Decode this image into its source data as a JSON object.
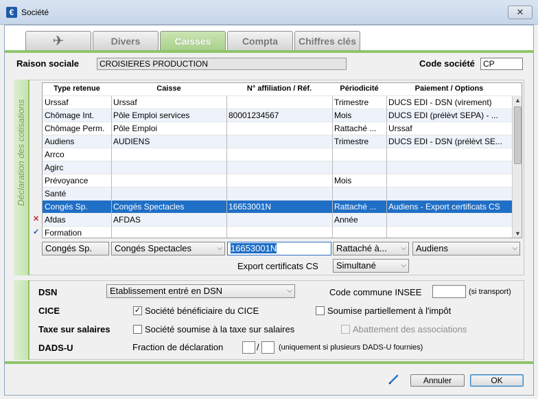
{
  "window": {
    "title": "Société",
    "app_icon": "€",
    "close_label": "✕"
  },
  "tabs": [
    {
      "label": "",
      "icon": "plane-icon"
    },
    {
      "label": "Divers"
    },
    {
      "label": "Caisses",
      "active": true
    },
    {
      "label": "Compta"
    },
    {
      "label": "Chiffres clés"
    }
  ],
  "header": {
    "raison_label": "Raison sociale",
    "raison_value": "CROISIERES PRODUCTION",
    "code_label": "Code société",
    "code_value": "CP"
  },
  "declaration": {
    "section_label": "Déclaration des cotisations",
    "columns": [
      "Type retenue",
      "Caisse",
      "N° affiliation / Réf.",
      "Périodicité",
      "Paiement / Options"
    ],
    "rows": [
      {
        "type": "Urssaf",
        "caisse": "Urssaf",
        "affil": "",
        "period": "Trimestre",
        "paiement": "DUCS EDI - DSN (virement)"
      },
      {
        "type": "Chômage Int.",
        "caisse": "Pôle Emploi services",
        "affil": "80001234567",
        "period": "Mois",
        "paiement": "DUCS EDI (prélèvt SEPA) - ..."
      },
      {
        "type": "Chômage Perm.",
        "caisse": "Pôle Emploi",
        "affil": "",
        "period": "Rattaché ...",
        "paiement": "Urssaf"
      },
      {
        "type": "Audiens",
        "caisse": "AUDIENS",
        "affil": "",
        "period": "Trimestre",
        "paiement": "DUCS EDI - DSN (prélèvt SE..."
      },
      {
        "type": "Arrco",
        "caisse": "",
        "affil": "",
        "period": "",
        "paiement": ""
      },
      {
        "type": "Agirc",
        "caisse": "",
        "affil": "",
        "period": "",
        "paiement": ""
      },
      {
        "type": "Prévoyance",
        "caisse": "",
        "affil": "",
        "period": "Mois",
        "paiement": ""
      },
      {
        "type": "Santé",
        "caisse": "",
        "affil": "",
        "period": "",
        "paiement": ""
      },
      {
        "type": "Congés Sp.",
        "caisse": "Congés Spectacles",
        "affil": "16653001N",
        "period": "Rattaché ...",
        "paiement": "Audiens - Export certificats CS"
      },
      {
        "type": "Afdas",
        "caisse": "AFDAS",
        "affil": "",
        "period": "Année",
        "paiement": "",
        "mark": "✕"
      },
      {
        "type": "Formation",
        "caisse": "",
        "affil": "",
        "period": "",
        "paiement": "",
        "mark": "✓"
      }
    ],
    "selected_row": 8,
    "edit": {
      "type": "Congés Sp.",
      "caisse": "Congés Spectacles",
      "affil": "16653001N",
      "period": "Rattaché à...",
      "paiement": "Audiens"
    },
    "export_label": "Export certificats CS",
    "export_value": "Simultané"
  },
  "settings": {
    "dsn_label": "DSN",
    "dsn_value": "Etablissement entré en DSN",
    "insee_label": "Code commune INSEE",
    "insee_value": "",
    "insee_note": "(si transport)",
    "cice_label": "CICE",
    "cice_check_label": "Société bénéficiaire du CICE",
    "cice_checked": true,
    "impot_label": "Soumise partiellement à l'impôt",
    "taxe_label": "Taxe sur salaires",
    "taxe_check_label": "Société soumise à la taxe sur salaires",
    "abattement_label": "Abattement des associations",
    "dadsu_label": "DADS-U",
    "fraction_label": "Fraction de déclaration",
    "fraction_a": "",
    "fraction_sep": "/",
    "fraction_b": "",
    "fraction_note": "(uniquement si plusieurs DADS-U fournies)"
  },
  "footer": {
    "cancel_label": "Annuler",
    "ok_label": "OK"
  },
  "colors": {
    "accent_green": "#8fc46a",
    "selection_blue": "#1f6fc6"
  }
}
